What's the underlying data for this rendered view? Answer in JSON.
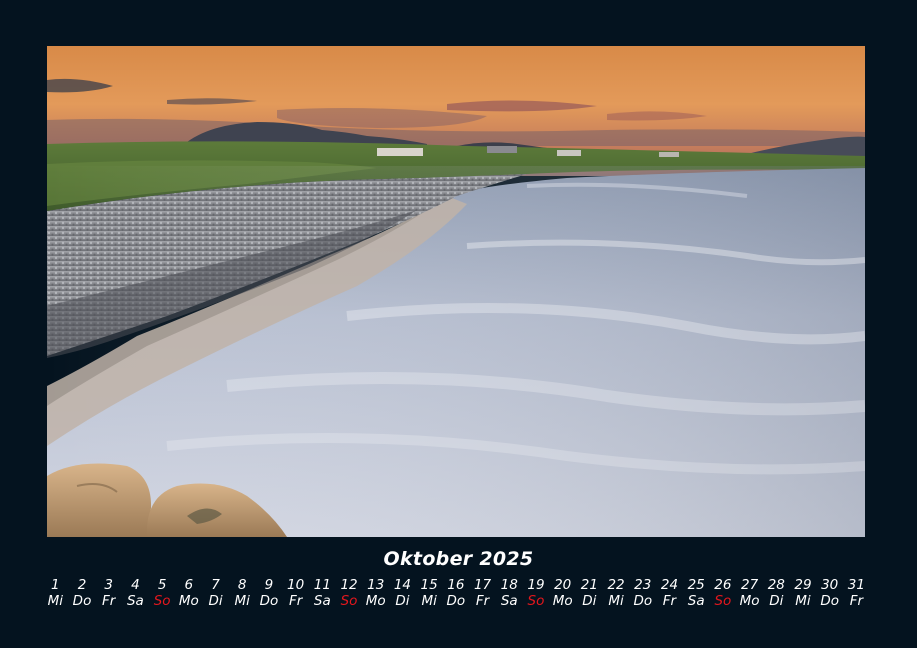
{
  "calendar": {
    "title": "Oktober 2025",
    "highlight_color": "#e2171d",
    "days": [
      {
        "n": "1",
        "wd": "Mi"
      },
      {
        "n": "2",
        "wd": "Do"
      },
      {
        "n": "3",
        "wd": "Fr"
      },
      {
        "n": "4",
        "wd": "Sa"
      },
      {
        "n": "5",
        "wd": "So",
        "sunday": true
      },
      {
        "n": "6",
        "wd": "Mo"
      },
      {
        "n": "7",
        "wd": "Di"
      },
      {
        "n": "8",
        "wd": "Mi"
      },
      {
        "n": "9",
        "wd": "Do"
      },
      {
        "n": "10",
        "wd": "Fr"
      },
      {
        "n": "11",
        "wd": "Sa"
      },
      {
        "n": "12",
        "wd": "So",
        "sunday": true
      },
      {
        "n": "13",
        "wd": "Mo"
      },
      {
        "n": "14",
        "wd": "Di"
      },
      {
        "n": "15",
        "wd": "Mi"
      },
      {
        "n": "16",
        "wd": "Do"
      },
      {
        "n": "17",
        "wd": "Fr"
      },
      {
        "n": "18",
        "wd": "Sa"
      },
      {
        "n": "19",
        "wd": "So",
        "sunday": true
      },
      {
        "n": "20",
        "wd": "Mo"
      },
      {
        "n": "21",
        "wd": "Di"
      },
      {
        "n": "22",
        "wd": "Mi"
      },
      {
        "n": "23",
        "wd": "Do"
      },
      {
        "n": "24",
        "wd": "Fr"
      },
      {
        "n": "25",
        "wd": "Sa"
      },
      {
        "n": "26",
        "wd": "So",
        "sunday": true
      },
      {
        "n": "27",
        "wd": "Mo"
      },
      {
        "n": "28",
        "wd": "Di"
      },
      {
        "n": "29",
        "wd": "Mi"
      },
      {
        "n": "30",
        "wd": "Do"
      },
      {
        "n": "31",
        "wd": "Fr"
      }
    ]
  }
}
